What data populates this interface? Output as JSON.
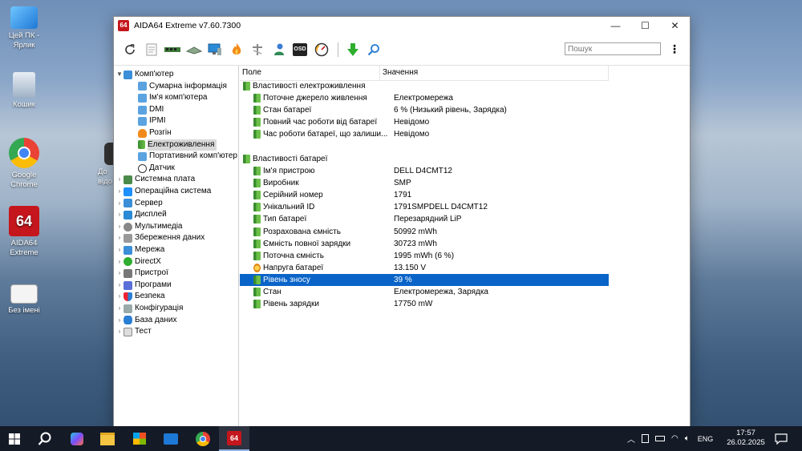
{
  "desktop": {
    "icons": [
      {
        "label": "Цей ПК - Ярлик"
      },
      {
        "label": "Кошик"
      },
      {
        "label": "Google Chrome"
      },
      {
        "label": "AIDA64 Extreme"
      },
      {
        "label": "Без імені"
      },
      {
        "label": "До відо"
      }
    ]
  },
  "window": {
    "title": "AIDA64 Extreme v7.60.7300",
    "logo_text": "64",
    "controls": {
      "minimize": "—",
      "maximize": "☐",
      "close": "✕"
    }
  },
  "toolbar": {
    "buttons": [
      "refresh-icon",
      "report-icon",
      "memory-icon",
      "motherboard-icon",
      "flame-icon",
      "network-tools-icon",
      "user-icon",
      "osd-icon",
      "gauge-icon",
      "download-icon",
      "search-icon"
    ],
    "osd_label": "OSD",
    "search_placeholder": "Пошук",
    "menu_glyph": "⋮"
  },
  "tree": {
    "root": "Комп'ютер",
    "children": [
      "Сумарна інформація",
      "Ім'я комп'ютера",
      "DMI",
      "IPMI",
      "Розгін",
      "Електроживлення",
      "Портативний комп'ютер",
      "Датчик"
    ],
    "sections": [
      "Системна плата",
      "Операційна система",
      "Сервер",
      "Дисплей",
      "Мультимедіа",
      "Збереження даних",
      "Мережа",
      "DirectX",
      "Пристрої",
      "Програми",
      "Безпека",
      "Конфігурація",
      "База даних",
      "Тест"
    ]
  },
  "list": {
    "headers": {
      "field": "Поле",
      "value": "Значення"
    },
    "group1": "Властивості електроживлення",
    "rows1": [
      {
        "field": "Поточне джерело живлення",
        "value": "Електромережа"
      },
      {
        "field": "Стан батареї",
        "value": "6 % (Низький рівень, Зарядка)"
      },
      {
        "field": "Повний час роботи від батареї",
        "value": "Невідомо"
      },
      {
        "field": "Час роботи батареї, що залиши...",
        "value": "Невідомо"
      }
    ],
    "group2": "Властивості батареї",
    "rows2": [
      {
        "field": "Ім'я пристрою",
        "value": "DELL D4CMT12"
      },
      {
        "field": "Виробник",
        "value": "SMP"
      },
      {
        "field": "Серійний номер",
        "value": "1791"
      },
      {
        "field": "Унікальний ID",
        "value": "1791SMPDELL D4CMT12"
      },
      {
        "field": "Тип батареї",
        "value": "Перезарядний LiP"
      },
      {
        "field": "Розрахована ємність",
        "value": "50992 mWh"
      },
      {
        "field": "Ємність повної зарядки",
        "value": "30723 mWh"
      },
      {
        "field": "Поточна ємність",
        "value": "1995 mWh  (6 %)"
      },
      {
        "field": "Напруга батареї",
        "value": "13.150 V"
      },
      {
        "field": "Рівень зносу",
        "value": "39 %"
      },
      {
        "field": "Стан",
        "value": "Електромережа, Зарядка"
      },
      {
        "field": "Рівень зарядки",
        "value": "17750 mW"
      }
    ]
  },
  "taskbar": {
    "language": "ENG",
    "time": "17:57",
    "date": "26.02.2025",
    "active_app_label": "64"
  },
  "colors": {
    "selection": "#0a64c8",
    "taskbar": "#141a26",
    "aida_red": "#c4161c"
  }
}
